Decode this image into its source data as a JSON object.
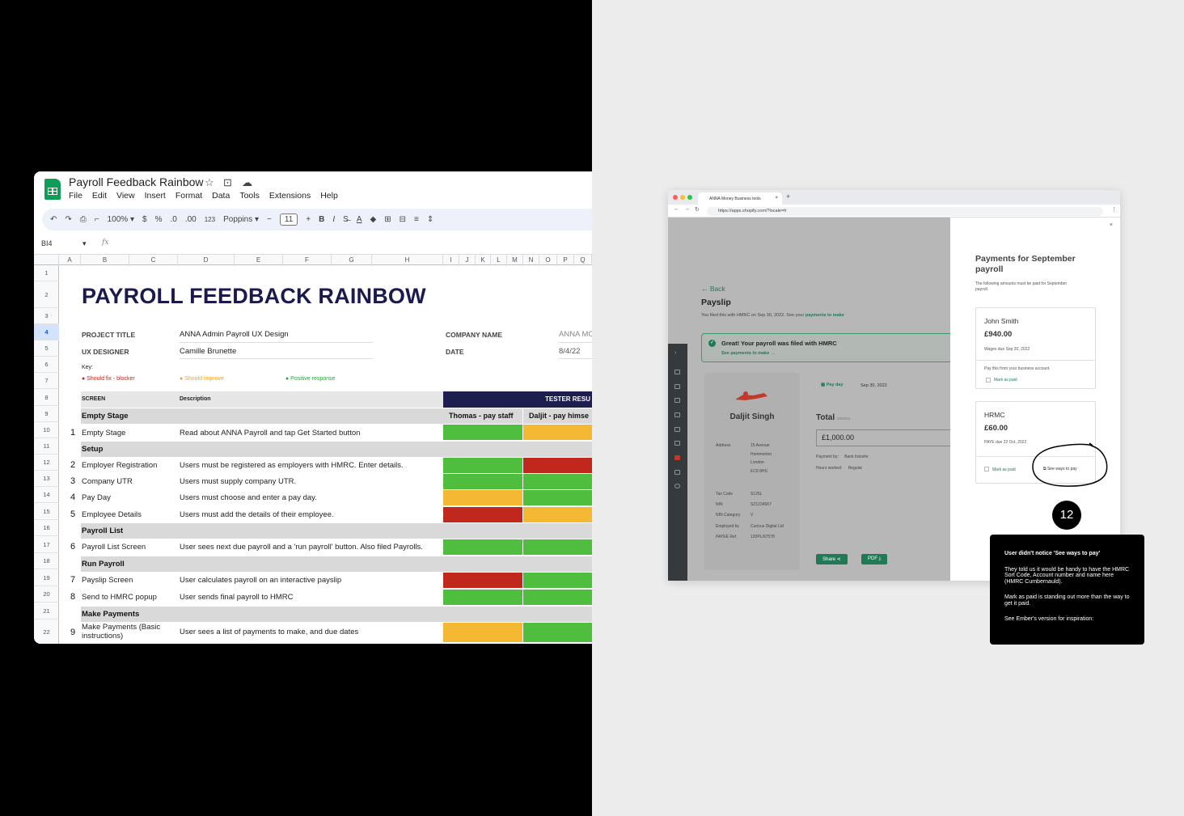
{
  "sheets": {
    "doc_title": "Payroll Feedback Rainbow",
    "menu": [
      "File",
      "Edit",
      "View",
      "Insert",
      "Format",
      "Data",
      "Tools",
      "Extensions",
      "Help"
    ],
    "toolbar": {
      "zoom": "100%",
      "currency": "$",
      "percent": "%",
      "dec_less": ".0",
      "dec_more": ".00",
      "format_123": "123",
      "font": "Poppins",
      "font_size": "11",
      "minus": "−",
      "plus": "+",
      "bold": "B",
      "italic": "I"
    },
    "name_box": "BI4",
    "fx": "fx",
    "columns": [
      "A",
      "B",
      "C",
      "D",
      "E",
      "F",
      "G",
      "H",
      "I",
      "J",
      "K",
      "L",
      "M",
      "N",
      "O",
      "P",
      "Q"
    ],
    "rows": [
      "1",
      "2",
      "3",
      "4",
      "5",
      "6",
      "7",
      "8",
      "9",
      "10",
      "11",
      "12",
      "13",
      "14",
      "15",
      "16",
      "17",
      "18",
      "19",
      "20",
      "21",
      "22"
    ],
    "title": "PAYROLL FEEDBACK RAINBOW",
    "project_title_label": "PROJECT TITLE",
    "project_title": "ANNA Admin Payroll UX Design",
    "ux_designer_label": "UX DESIGNER",
    "ux_designer": "Camille Brunette",
    "company_name_label": "COMPANY NAME",
    "company_name": "ANNA MO",
    "date_label": "DATE",
    "date": "8/4/22",
    "key_label": "Key:",
    "key_red": "● Should fix - blocker",
    "key_yellow": "● Should improve",
    "key_green": "● Positive response",
    "screen_header": "SCREEN",
    "description_header": "Description",
    "tester_results": "TESTER RESU",
    "tester1": "Thomas - pay staff",
    "tester2": "Daljit - pay himse",
    "sections": {
      "empty_stage": "Empty Stage",
      "setup": "Setup",
      "payroll_list": "Payroll List",
      "run_payroll": "Run Payroll",
      "make_payments": "Make Payments"
    },
    "items": [
      {
        "n": "1",
        "screen": "Empty Stage",
        "desc": "Read about ANNA Payroll and tap Get Started button",
        "t1": "green",
        "t2": "yellow"
      },
      {
        "n": "2",
        "screen": "Employer Registration",
        "desc": "Users must be registered as employers with HMRC. Enter details.",
        "t1": "green",
        "t2": "red"
      },
      {
        "n": "3",
        "screen": "Company UTR",
        "desc": "Users must supply company UTR.",
        "t1": "green",
        "t2": "green"
      },
      {
        "n": "4",
        "screen": "Pay Day",
        "desc": "Users must choose and enter a pay day.",
        "t1": "yellow",
        "t2": "green"
      },
      {
        "n": "5",
        "screen": "Employee Details",
        "desc": "Users must add the details of their employee.",
        "t1": "red",
        "t2": "yellow"
      },
      {
        "n": "6",
        "screen": "Payroll List Screen",
        "desc": "User sees next due payroll and a 'run payroll' button. Also filed Payrolls.",
        "t1": "green",
        "t2": "green"
      },
      {
        "n": "7",
        "screen": "Payslip Screen",
        "desc": "User calculates payroll on an interactive payslip",
        "t1": "red",
        "t2": "green"
      },
      {
        "n": "8",
        "screen": "Send to HMRC popup",
        "desc": "User sends final payroll to HMRC",
        "t1": "green",
        "t2": "green"
      },
      {
        "n": "9",
        "screen": "Make Payments (Basic instructions)",
        "desc": "User sees a list of payments to make, and due dates",
        "t1": "yellow",
        "t2": "green"
      }
    ]
  },
  "colors": {
    "green": "#4fbe3f",
    "yellow": "#f4b833",
    "red": "#c0281e",
    "navy": "#1d1d4f",
    "brand_green": "#1f7a55"
  },
  "browser": {
    "tab_title": "ANNA Money Business tools",
    "url": "https://apps.shopify.com/?locale=fr",
    "back": "← Back",
    "payslip": "Payslip",
    "filed_text": "You filed this with HMRC on Sep 30, 2022. See your",
    "filed_link": "payments to make",
    "success_title": "Great! Your payroll was filed with HMRC",
    "success_link": "See payments to make →",
    "employee_name": "Daljit Singh",
    "address_label": "Address",
    "address": [
      "15 Avenue",
      "Hommerton",
      "London",
      "EC8 8HS"
    ],
    "fields": [
      {
        "label": "Tax Code",
        "value": "S125L"
      },
      {
        "label": "NIN",
        "value": "SZ1234567"
      },
      {
        "label": "NIN Category",
        "value": "V"
      },
      {
        "label": "Employed by",
        "value": "Curious Digital Ltd"
      },
      {
        "label": "PAYEE Ref.",
        "value": "120PL/67578"
      }
    ],
    "payday_label": "Pay day",
    "payday_date": "Sep 30, 2022",
    "total_label": "Total",
    "total_sub": "GROSS",
    "total_value": "£1,000.00",
    "payment_by_label": "Payment by:",
    "payment_by": "Bank transfer",
    "hours_label": "Hours worked:",
    "hours": "Regular",
    "share": "Share ⋖",
    "pdf": "PDF ⤓",
    "panel_title": "Payments for September payroll",
    "panel_sub": "The following amounts must be paid for September payroll.",
    "card1": {
      "name": "John Smith",
      "amount": "£940.00",
      "due": "Wages due Sep 30, 2022",
      "note": "Pay this from your business account.",
      "mark": "Mark as paid"
    },
    "card2": {
      "name": "HRMC",
      "amount": "£60.00",
      "due": "PAYE due 22 Oct, 2022",
      "mark": "Mark as paid",
      "ways": "See ways to pay"
    },
    "close": "×"
  },
  "annotation": {
    "badge": "12",
    "heading": "User didn't notice 'See ways to pay'",
    "p1": "They told us it would be handy to have the HMRC Sort Code, Account number and name here (HMRC Cumbernauld).",
    "p2": "Mark as paid is standing out more than the way to get it paid.",
    "p3": "See Ember's version for inspiration:"
  }
}
